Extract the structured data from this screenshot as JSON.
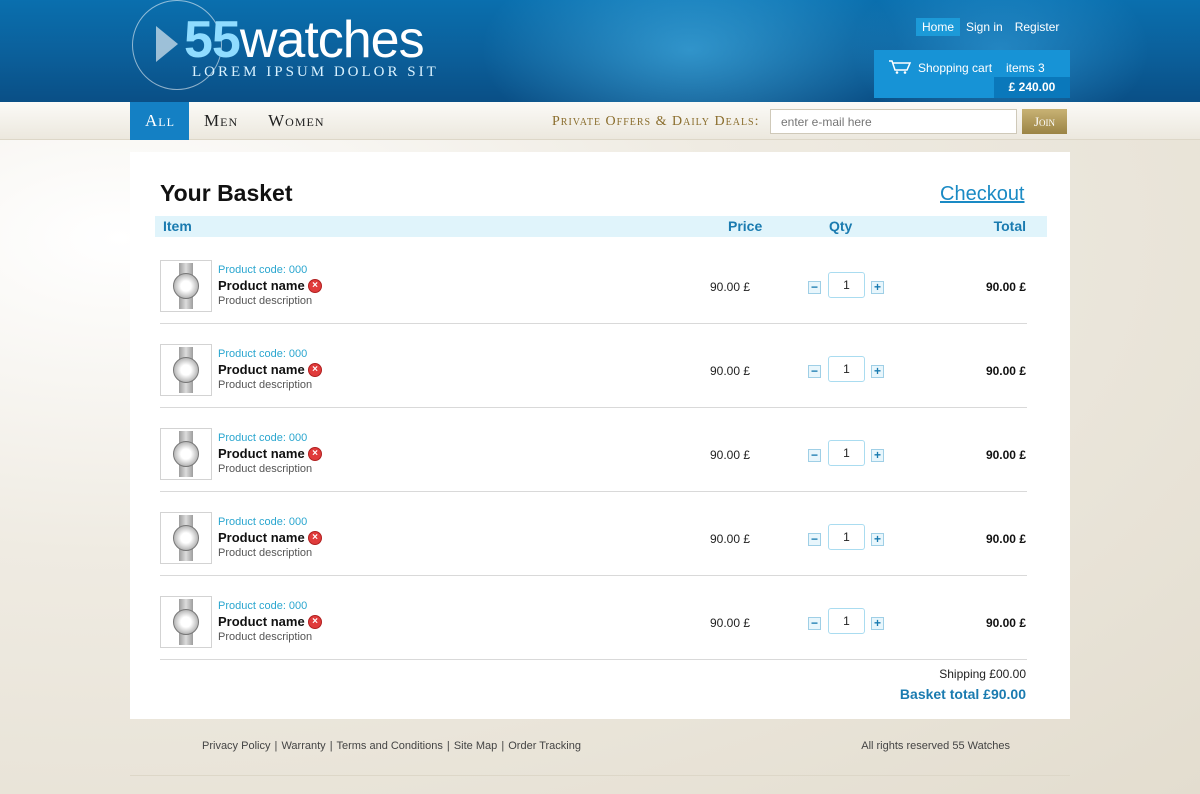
{
  "brand": {
    "name_bold": "55",
    "name_rest": "watches",
    "tagline": "LOREM IPSUM DOLOR SIT"
  },
  "toplinks": [
    {
      "label": "Home"
    },
    {
      "label": "Sign in"
    },
    {
      "label": "Register"
    }
  ],
  "cart": {
    "label": "Shopping cart",
    "items": "items 3",
    "amount": "£ 240.00"
  },
  "nav": {
    "tabs": [
      {
        "label": "All"
      },
      {
        "label": "Men"
      },
      {
        "label": "Women"
      }
    ],
    "promo": "Private Offers & Daily Deals:",
    "email_placeholder": "enter e-mail here",
    "join_label": "Join"
  },
  "basket": {
    "title": "Your Basket",
    "checkout": "Checkout",
    "headers": {
      "item": "Item",
      "price": "Price",
      "qty": "Qty",
      "total": "Total"
    },
    "rows": [
      {
        "code": "Product code: 000",
        "name": "Product name",
        "desc": "Product description",
        "price": "90.00 £",
        "qty": "1",
        "total": "90.00 £"
      },
      {
        "code": "Product code: 000",
        "name": "Product name",
        "desc": "Product description",
        "price": "90.00 £",
        "qty": "1",
        "total": "90.00 £"
      },
      {
        "code": "Product code: 000",
        "name": "Product name",
        "desc": "Product description",
        "price": "90.00 £",
        "qty": "1",
        "total": "90.00 £"
      },
      {
        "code": "Product code: 000",
        "name": "Product name",
        "desc": "Product description",
        "price": "90.00 £",
        "qty": "1",
        "total": "90.00 £"
      },
      {
        "code": "Product code: 000",
        "name": "Product name",
        "desc": "Product description",
        "price": "90.00 £",
        "qty": "1",
        "total": "90.00 £"
      }
    ],
    "minus_glyph": "−",
    "plus_glyph": "+",
    "remove_glyph": "×",
    "shipping": "Shipping £00.00",
    "basket_total": "Basket total £90.00"
  },
  "footer": {
    "links": [
      {
        "label": "Privacy Policy"
      },
      {
        "label": "Warranty"
      },
      {
        "label": "Terms and Conditions"
      },
      {
        "label": "Site Map"
      },
      {
        "label": "Order Tracking"
      }
    ],
    "separator": "|",
    "copyright": "All rights reserved 55 Watches"
  },
  "colors": {
    "header_blue": "#0b5f9a",
    "accent_blue": "#1480c4",
    "link_blue": "#1a8ac4",
    "gold": "#9b8445",
    "remove_red": "#e03b3b"
  },
  "icons": [
    "cart-icon",
    "remove-icon",
    "minus-icon",
    "plus-icon",
    "watch-thumbnail"
  ]
}
